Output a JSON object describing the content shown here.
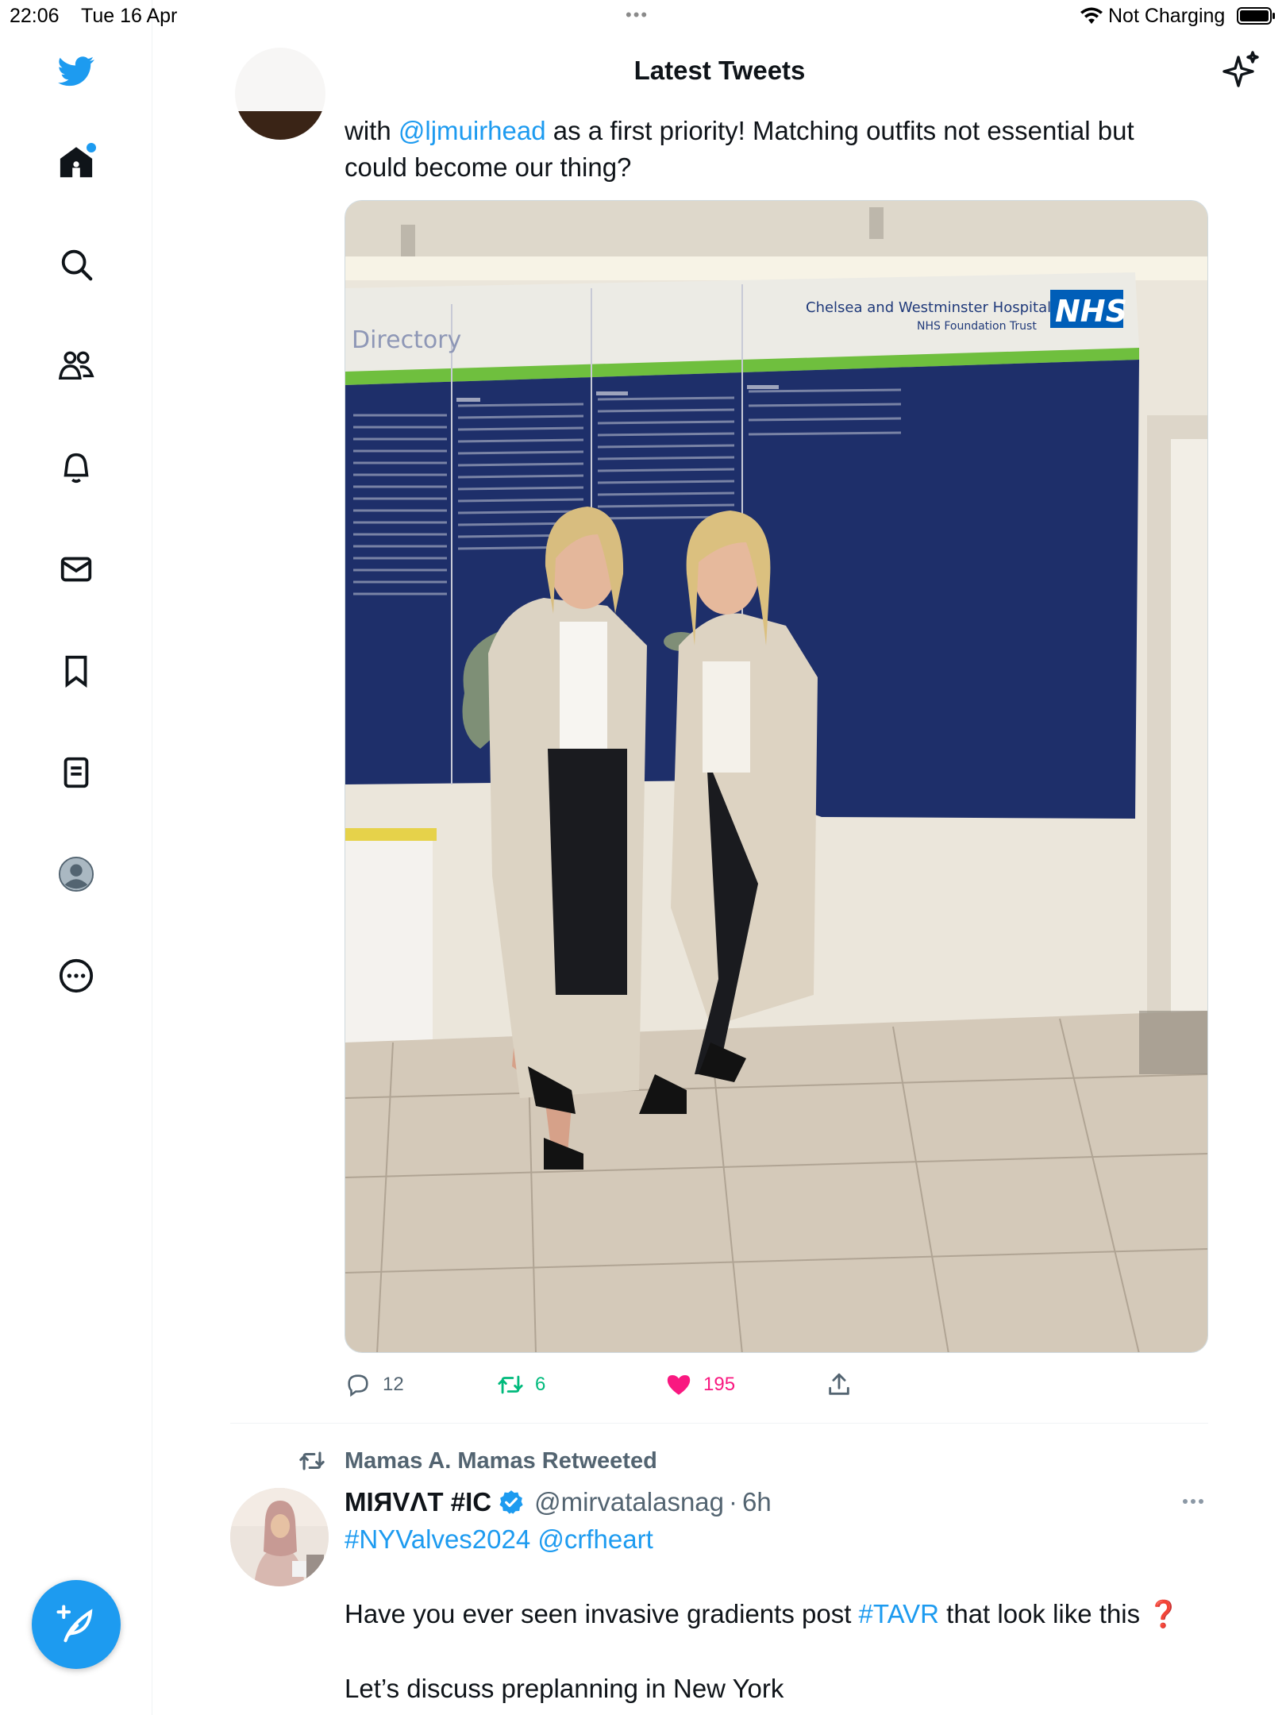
{
  "status_bar": {
    "time": "22:06",
    "date": "Tue 16 Apr",
    "dots": "•••",
    "charging": "Not Charging"
  },
  "sidebar": {
    "items": [
      {
        "icon": "twitter-bird-icon"
      },
      {
        "icon": "home-icon",
        "notification_dot": true
      },
      {
        "icon": "search-icon"
      },
      {
        "icon": "communities-icon"
      },
      {
        "icon": "notifications-icon"
      },
      {
        "icon": "messages-icon"
      },
      {
        "icon": "bookmarks-icon"
      },
      {
        "icon": "lists-icon"
      },
      {
        "icon": "profile-icon"
      },
      {
        "icon": "more-icon"
      }
    ],
    "compose_icon": "compose-tweet-icon"
  },
  "header": {
    "title": "Latest Tweets",
    "sparkle_icon": "sparkle-icon"
  },
  "tweet1": {
    "text_prefix": "with ",
    "mention": "@ljmuirhead",
    "text_suffix": " as a first priority! Matching outfits not essential but could become our thing?",
    "photo_text": {
      "directory_label": "Directory",
      "hospital_line1": "Chelsea and Westminster Hospital",
      "hospital_line2": "NHS Foundation Trust",
      "nhs_logo": "NHS"
    },
    "actions": {
      "replies": "12",
      "retweets": "6",
      "likes": "195"
    }
  },
  "tweet2": {
    "retweeted_by": "Mamas A. Mamas Retweeted",
    "display_name": "MIЯVΛT #IC",
    "handle": "@mirvatalasnag",
    "separator": "·",
    "time": "6h",
    "hashtag1": "#NYValves2024",
    "mention1": "@crfheart",
    "line2_prefix": "Have you ever seen invasive gradients post ",
    "hashtag2": "#TAVR",
    "line2_suffix": " that look like this ",
    "alert": "❓",
    "line3": "Let’s discuss preplanning in New York"
  },
  "colors": {
    "accent": "#1d9bf0",
    "retweet": "#00ba7c",
    "like": "#f91880",
    "secondary_text": "#536471",
    "nhs_blue": "#005eb8"
  }
}
